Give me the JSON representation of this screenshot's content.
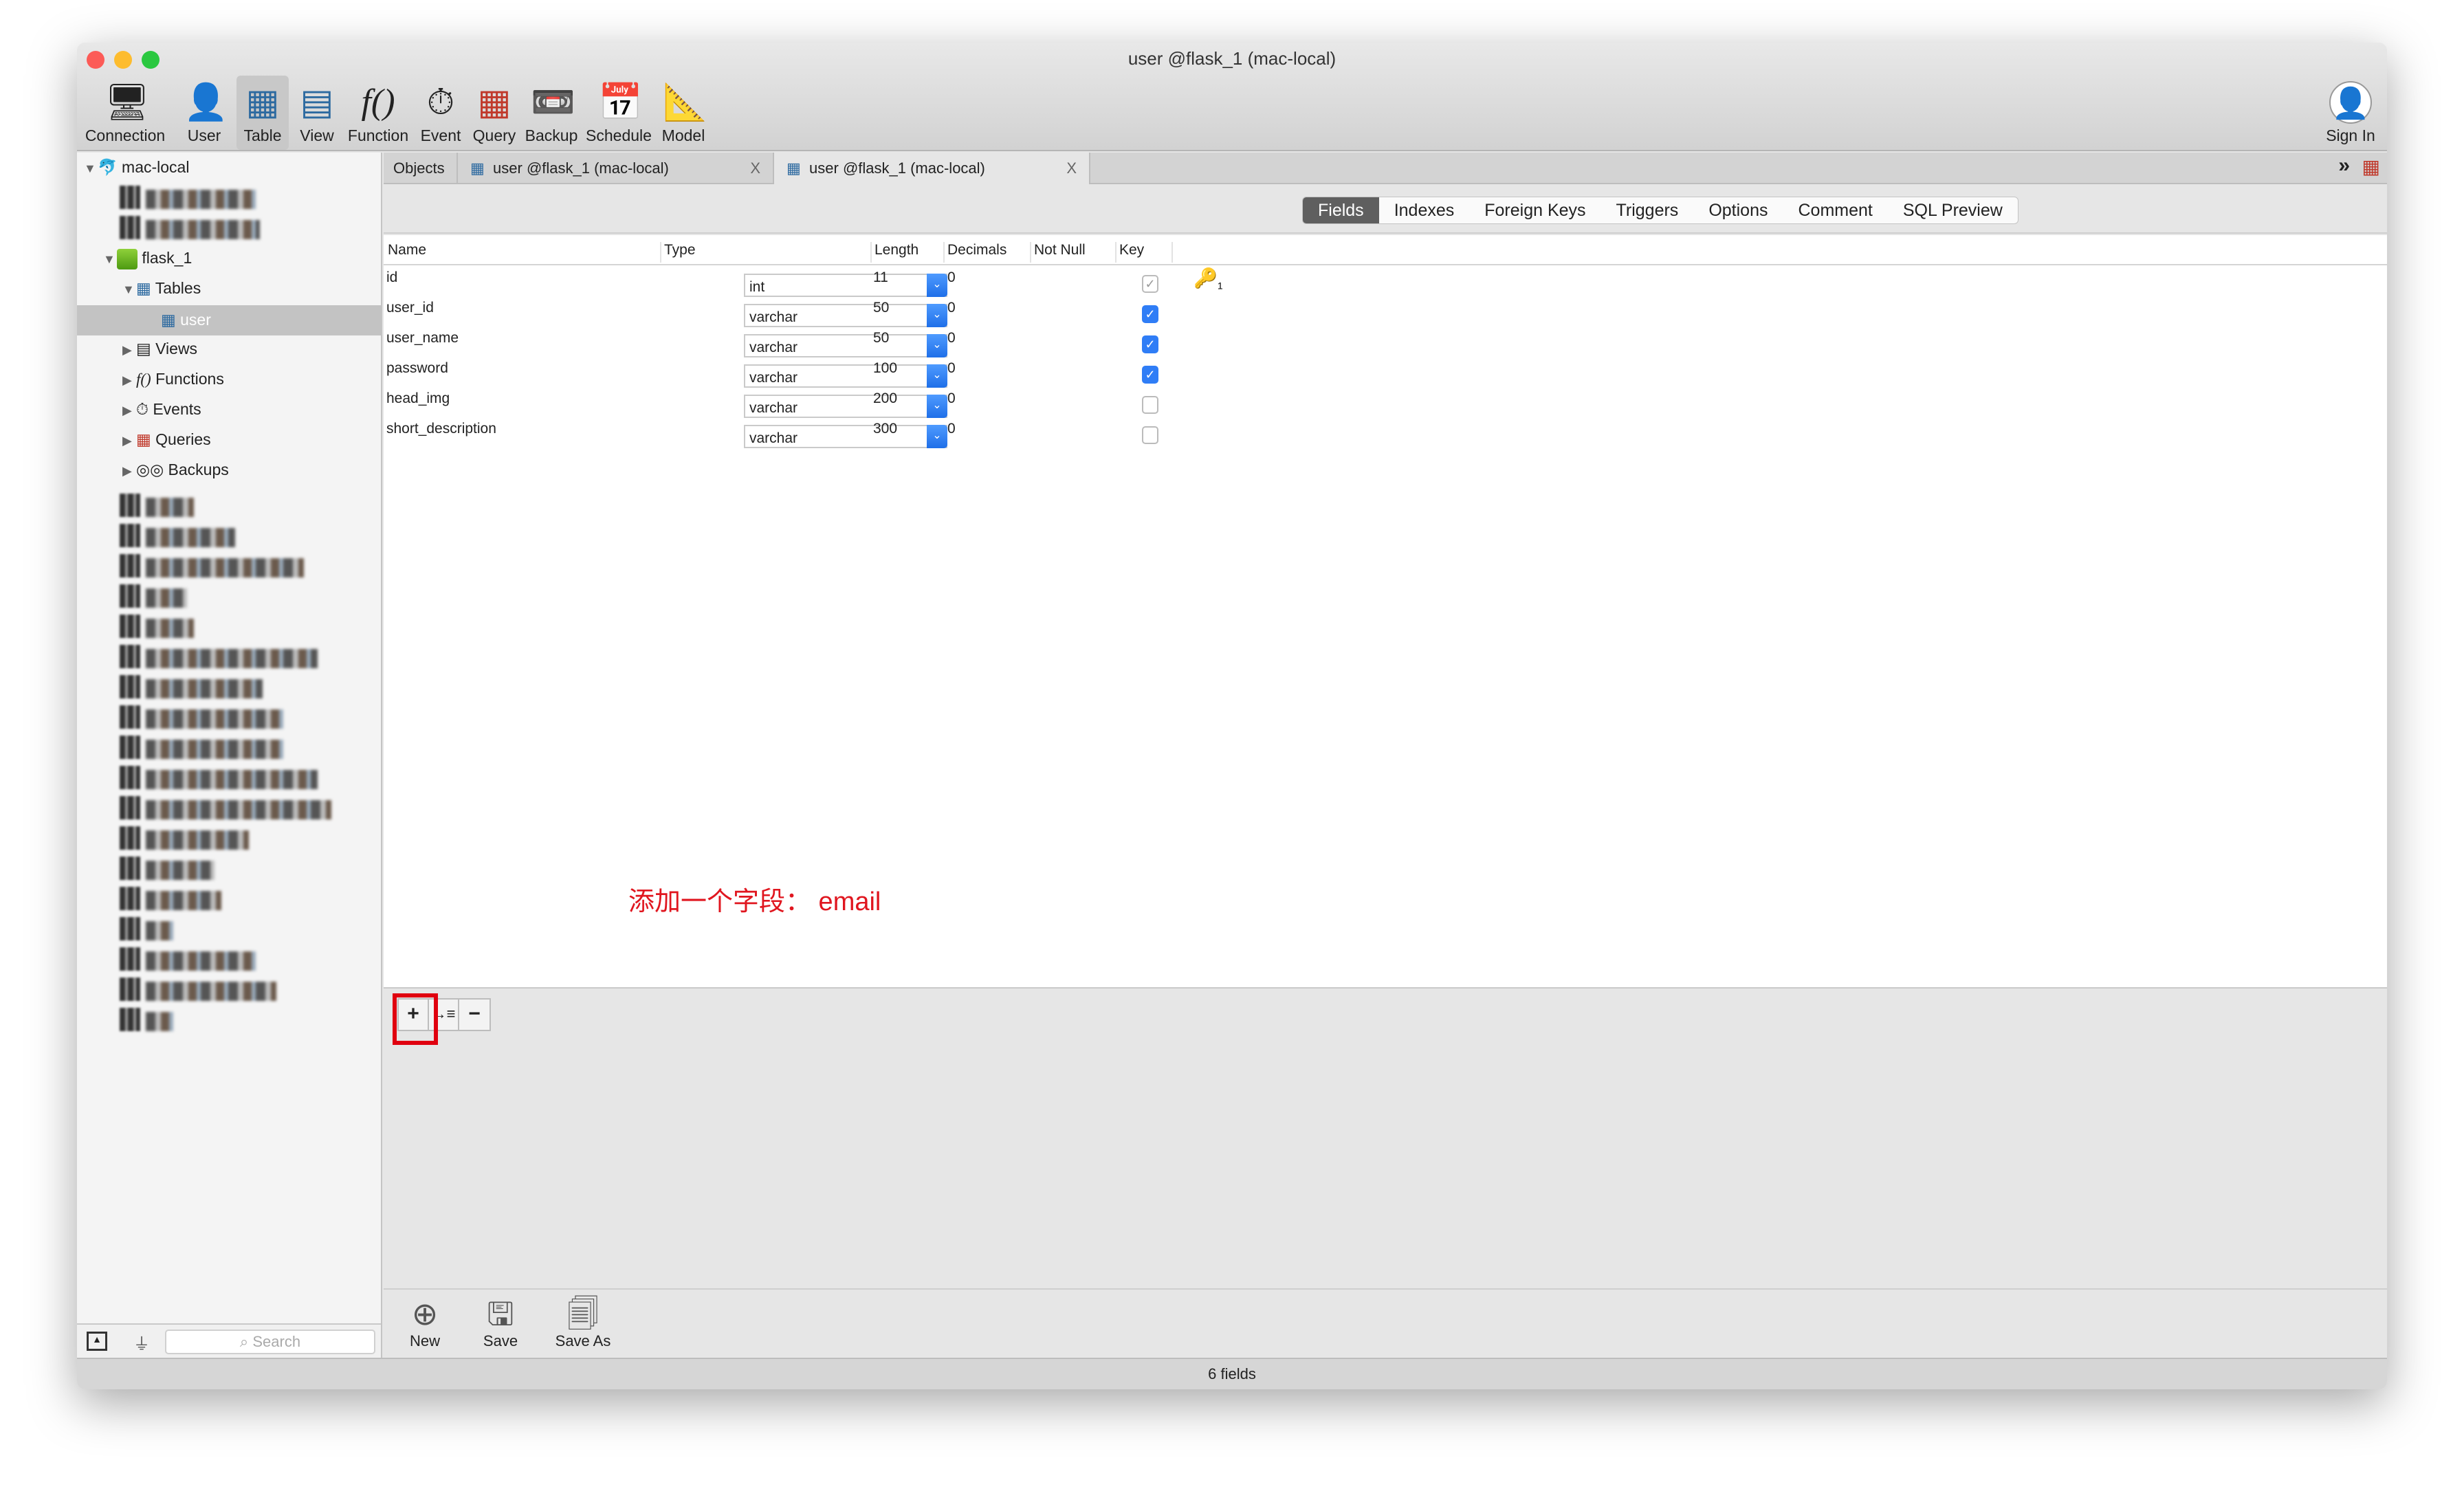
{
  "window": {
    "title": "user @flask_1 (mac-local)"
  },
  "toolbar": {
    "items": [
      {
        "label": "Connection",
        "icon": "connection-icon"
      },
      {
        "label": "User",
        "icon": "user-icon"
      },
      {
        "label": "Table",
        "icon": "table-icon",
        "active": true
      },
      {
        "label": "View",
        "icon": "view-icon"
      },
      {
        "label": "Function",
        "icon": "function-icon"
      },
      {
        "label": "Event",
        "icon": "event-icon"
      },
      {
        "label": "Query",
        "icon": "query-icon"
      },
      {
        "label": "Backup",
        "icon": "backup-icon"
      },
      {
        "label": "Schedule",
        "icon": "schedule-icon"
      },
      {
        "label": "Model",
        "icon": "model-icon"
      }
    ],
    "sign_in": "Sign In"
  },
  "sidebar": {
    "connection": "mac-local",
    "database": "flask_1",
    "tables_label": "Tables",
    "selected_table": "user",
    "groups": [
      "Views",
      "Functions",
      "Events",
      "Queries",
      "Backups"
    ],
    "search_placeholder": "Search"
  },
  "tabs": {
    "objects": "Objects",
    "tab1": "user @flask_1 (mac-local)",
    "tab2": "user @flask_1 (mac-local)",
    "close": "X"
  },
  "subtabs": [
    "Fields",
    "Indexes",
    "Foreign Keys",
    "Triggers",
    "Options",
    "Comment",
    "SQL Preview"
  ],
  "columns": [
    "Name",
    "Type",
    "Length",
    "Decimals",
    "Not Null",
    "Key"
  ],
  "fields": [
    {
      "name": "id",
      "type": "int",
      "length": "11",
      "decimals": "0",
      "not_null": true,
      "not_null_disabled": true,
      "key": "1"
    },
    {
      "name": "user_id",
      "type": "varchar",
      "length": "50",
      "decimals": "0",
      "not_null": true
    },
    {
      "name": "user_name",
      "type": "varchar",
      "length": "50",
      "decimals": "0",
      "not_null": true
    },
    {
      "name": "password",
      "type": "varchar",
      "length": "100",
      "decimals": "0",
      "not_null": true
    },
    {
      "name": "head_img",
      "type": "varchar",
      "length": "200",
      "decimals": "0",
      "not_null": false
    },
    {
      "name": "short_description",
      "type": "varchar",
      "length": "300",
      "decimals": "0",
      "not_null": false
    }
  ],
  "field_buttons": {
    "add": "+",
    "insert": "→≡",
    "remove": "−"
  },
  "annotation": "添加一个字段： email",
  "bottom": {
    "new": "New",
    "save": "Save",
    "save_as": "Save As"
  },
  "status": "6 fields",
  "colors": {
    "accent": "#2f7df6",
    "annotation": "#e0161f",
    "highlight_box": "#e0000f"
  }
}
